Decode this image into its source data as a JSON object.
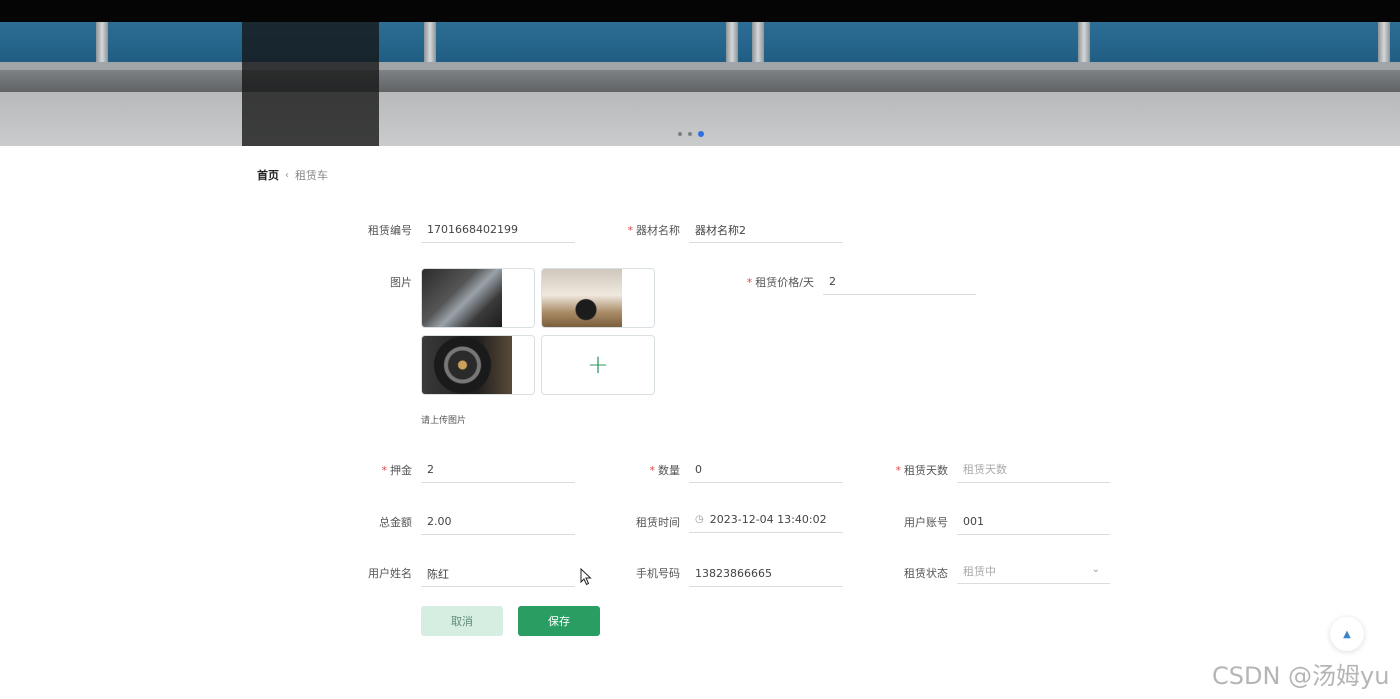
{
  "banner": {
    "slide_count": 3,
    "active_slide": 3
  },
  "breadcrumb": {
    "home": "首页",
    "separator": "‹",
    "current": "租赁车"
  },
  "form": {
    "rental_no": {
      "label": "租赁编号",
      "value": "1701668402199"
    },
    "equip_name": {
      "label": "器材名称",
      "value": "器材名称2"
    },
    "image": {
      "label": "图片",
      "hint": "请上传图片",
      "add": "+"
    },
    "price": {
      "label": "租赁价格/天",
      "value": "2"
    },
    "deposit": {
      "label": "押金",
      "value": "2"
    },
    "quantity": {
      "label": "数量",
      "value": "0"
    },
    "days": {
      "label": "租赁天数",
      "placeholder": "租赁天数"
    },
    "total": {
      "label": "总金额",
      "value": "2.00"
    },
    "rent_time": {
      "label": "租赁时间",
      "value": "2023-12-04 13:40:02"
    },
    "user_account": {
      "label": "用户账号",
      "value": "001"
    },
    "user_name": {
      "label": "用户姓名",
      "value": "陈红"
    },
    "phone": {
      "label": "手机号码",
      "value": "13823866665"
    },
    "status": {
      "label": "租赁状态",
      "value": "租赁中"
    },
    "required_mark": "*"
  },
  "buttons": {
    "cancel": "取消",
    "save": "保存"
  },
  "watermark": "CSDN @汤姆yu",
  "colors": {
    "primary": "#2a9d62",
    "primary_light": "#d6ede2",
    "required": "#e04848",
    "accent_blue": "#2f6fe4"
  }
}
